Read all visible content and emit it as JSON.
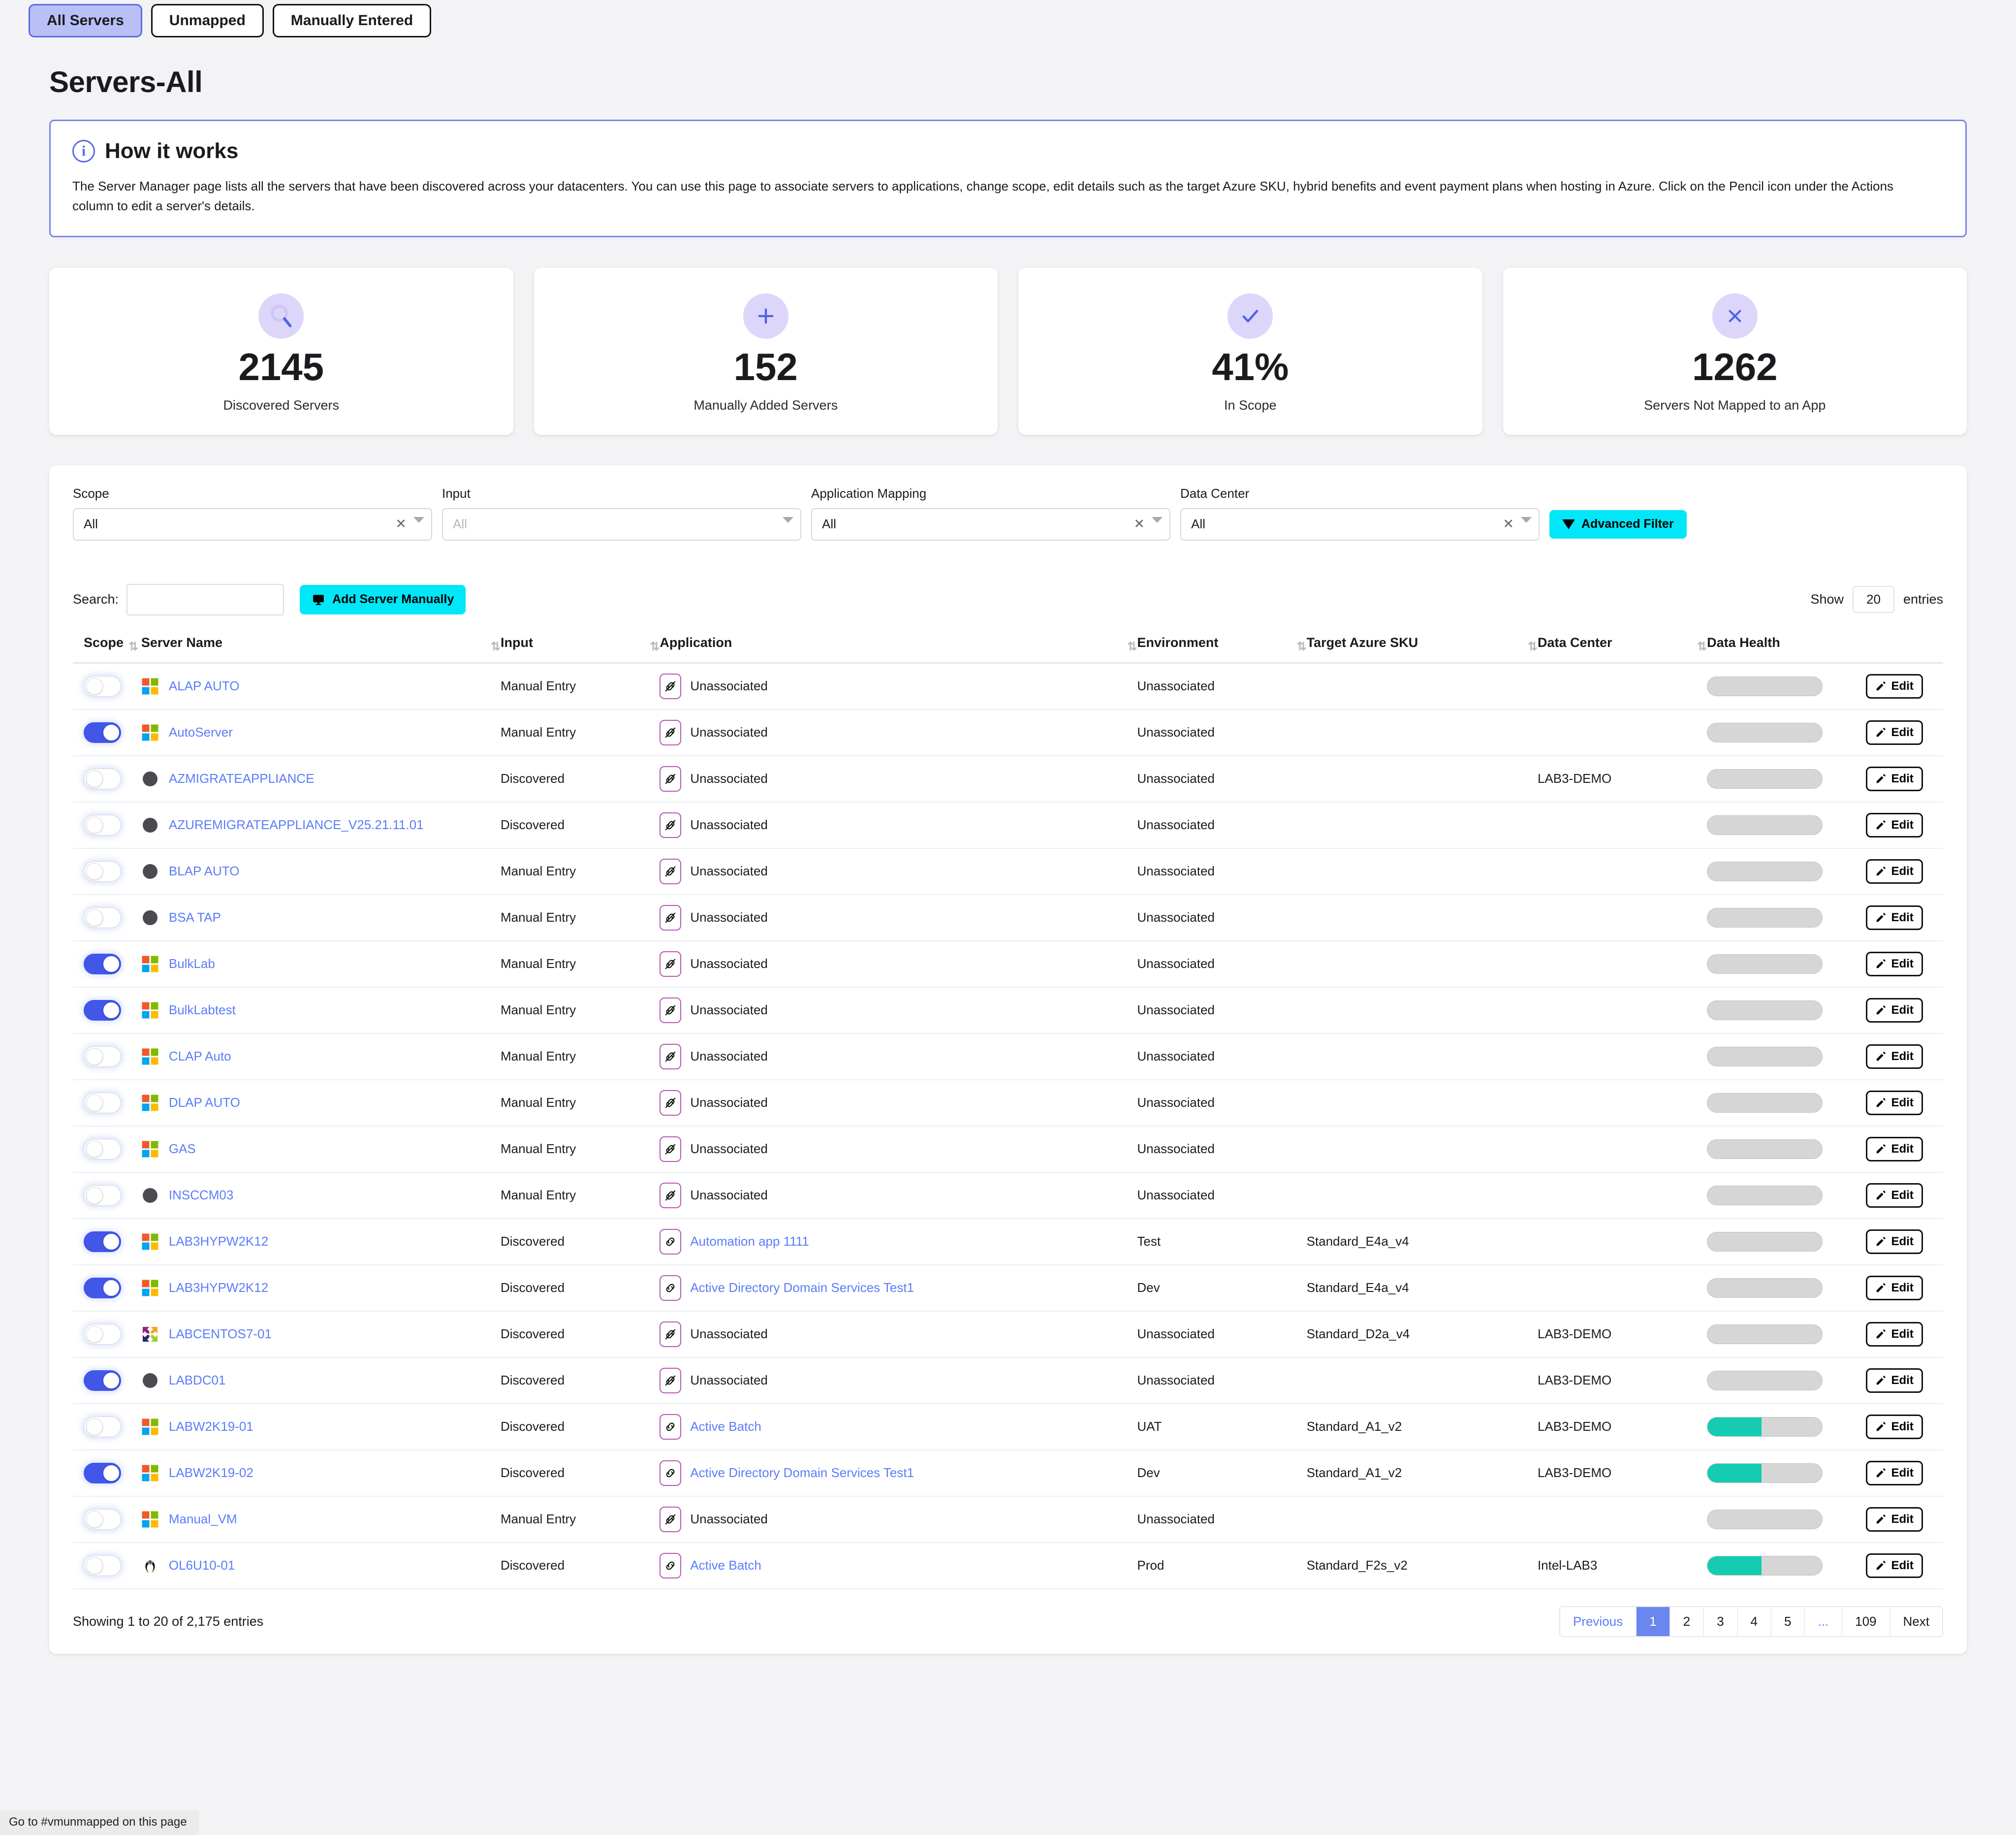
{
  "tabs": [
    {
      "label": "All Servers",
      "active": true
    },
    {
      "label": "Unmapped",
      "active": false
    },
    {
      "label": "Manually Entered",
      "active": false
    }
  ],
  "page_title": "Servers-All",
  "how_it_works": {
    "icon": "info-icon",
    "title": "How it works",
    "body": "The Server Manager page lists all the servers that have been discovered across your datacenters. You can use this page to associate servers to applications, change scope, edit details such as the target Azure SKU, hybrid benefits and event payment plans when hosting in Azure. Click on the Pencil icon under the Actions column to edit a server's details."
  },
  "stats": [
    {
      "icon": "magnifier-icon",
      "value": "2145",
      "label": "Discovered Servers"
    },
    {
      "icon": "plus-icon",
      "value": "152",
      "label": "Manually Added Servers"
    },
    {
      "icon": "check-icon",
      "value": "41%",
      "label": "In Scope"
    },
    {
      "icon": "x-icon",
      "value": "1262",
      "label": "Servers Not Mapped to an App"
    }
  ],
  "filters": [
    {
      "label": "Scope",
      "value": "All",
      "placeholder": "All",
      "has_clear": true,
      "is_placeholder": false
    },
    {
      "label": "Input",
      "value": "All",
      "placeholder": "All",
      "has_clear": false,
      "is_placeholder": true
    },
    {
      "label": "Application Mapping",
      "value": "All",
      "placeholder": "All",
      "has_clear": true,
      "is_placeholder": false
    },
    {
      "label": "Data Center",
      "value": "All",
      "placeholder": "All",
      "has_clear": true,
      "is_placeholder": false
    }
  ],
  "advanced_filter_label": "Advanced Filter",
  "advanced_filter_color": "#00e7f7",
  "search": {
    "label": "Search:",
    "value": "",
    "placeholder": ""
  },
  "add_server_label": "Add Server Manually",
  "show_entries": {
    "prefix": "Show",
    "value": "20",
    "suffix": "entries"
  },
  "table": {
    "columns": [
      "Scope",
      "Server Name",
      "Input",
      "Application",
      "Environment",
      "Target Azure SKU",
      "Data Center",
      "Data Health"
    ],
    "rows": [
      {
        "scope_on": false,
        "os": "windows",
        "name": "ALAP AUTO",
        "input": "Manual Entry",
        "app": "Unassociated",
        "app_linked": false,
        "env": "Unassociated",
        "sku": "",
        "dc": "",
        "health": 0,
        "action": "Edit"
      },
      {
        "scope_on": true,
        "os": "windows",
        "name": "AutoServer",
        "input": "Manual Entry",
        "app": "Unassociated",
        "app_linked": false,
        "env": "Unassociated",
        "sku": "",
        "dc": "",
        "health": 0,
        "action": "Edit"
      },
      {
        "scope_on": false,
        "os": "generic",
        "name": "AZMIGRATEAPPLIANCE",
        "input": "Discovered",
        "app": "Unassociated",
        "app_linked": false,
        "env": "Unassociated",
        "sku": "",
        "dc": "LAB3-DEMO",
        "health": 0,
        "action": "Edit"
      },
      {
        "scope_on": false,
        "os": "generic",
        "name": "AZUREMIGRATEAPPLIANCE_V25.21.11.01",
        "input": "Discovered",
        "app": "Unassociated",
        "app_linked": false,
        "env": "Unassociated",
        "sku": "",
        "dc": "",
        "health": 0,
        "action": "Edit"
      },
      {
        "scope_on": false,
        "os": "generic",
        "name": "BLAP AUTO",
        "input": "Manual Entry",
        "app": "Unassociated",
        "app_linked": false,
        "env": "Unassociated",
        "sku": "",
        "dc": "",
        "health": 0,
        "action": "Edit"
      },
      {
        "scope_on": false,
        "os": "generic",
        "name": "BSA TAP",
        "input": "Manual Entry",
        "app": "Unassociated",
        "app_linked": false,
        "env": "Unassociated",
        "sku": "",
        "dc": "",
        "health": 0,
        "action": "Edit"
      },
      {
        "scope_on": true,
        "os": "windows",
        "name": "BulkLab",
        "input": "Manual Entry",
        "app": "Unassociated",
        "app_linked": false,
        "env": "Unassociated",
        "sku": "",
        "dc": "",
        "health": 0,
        "action": "Edit"
      },
      {
        "scope_on": true,
        "os": "windows",
        "name": "BulkLabtest",
        "input": "Manual Entry",
        "app": "Unassociated",
        "app_linked": false,
        "env": "Unassociated",
        "sku": "",
        "dc": "",
        "health": 0,
        "action": "Edit"
      },
      {
        "scope_on": false,
        "os": "windows",
        "name": "CLAP Auto",
        "input": "Manual Entry",
        "app": "Unassociated",
        "app_linked": false,
        "env": "Unassociated",
        "sku": "",
        "dc": "",
        "health": 0,
        "action": "Edit"
      },
      {
        "scope_on": false,
        "os": "windows",
        "name": "DLAP AUTO",
        "input": "Manual Entry",
        "app": "Unassociated",
        "app_linked": false,
        "env": "Unassociated",
        "sku": "",
        "dc": "",
        "health": 0,
        "action": "Edit"
      },
      {
        "scope_on": false,
        "os": "windows",
        "name": "GAS",
        "input": "Manual Entry",
        "app": "Unassociated",
        "app_linked": false,
        "env": "Unassociated",
        "sku": "",
        "dc": "",
        "health": 0,
        "action": "Edit"
      },
      {
        "scope_on": false,
        "os": "generic",
        "name": "INSCCM03",
        "input": "Manual Entry",
        "app": "Unassociated",
        "app_linked": false,
        "env": "Unassociated",
        "sku": "",
        "dc": "",
        "health": 0,
        "action": "Edit"
      },
      {
        "scope_on": true,
        "os": "windows",
        "name": "LAB3HYPW2K12",
        "input": "Discovered",
        "app": "Automation app 1111",
        "app_linked": true,
        "env": "Test",
        "sku": "Standard_E4a_v4",
        "dc": "",
        "health": 0,
        "action": "Edit"
      },
      {
        "scope_on": true,
        "os": "windows",
        "name": "LAB3HYPW2K12",
        "input": "Discovered",
        "app": "Active Directory Domain Services Test1",
        "app_linked": true,
        "env": "Dev",
        "sku": "Standard_E4a_v4",
        "dc": "",
        "health": 0,
        "action": "Edit"
      },
      {
        "scope_on": false,
        "os": "centos",
        "name": "LABCENTOS7-01",
        "input": "Discovered",
        "app": "Unassociated",
        "app_linked": false,
        "env": "Unassociated",
        "sku": "Standard_D2a_v4",
        "dc": "LAB3-DEMO",
        "health": 0,
        "action": "Edit"
      },
      {
        "scope_on": true,
        "os": "generic",
        "name": "LABDC01",
        "input": "Discovered",
        "app": "Unassociated",
        "app_linked": false,
        "env": "Unassociated",
        "sku": "",
        "dc": "LAB3-DEMO",
        "health": 0,
        "action": "Edit"
      },
      {
        "scope_on": false,
        "os": "windows",
        "name": "LABW2K19-01",
        "input": "Discovered",
        "app": "Active Batch",
        "app_linked": true,
        "env": "UAT",
        "sku": "Standard_A1_v2",
        "dc": "LAB3-DEMO",
        "health": 47,
        "action": "Edit"
      },
      {
        "scope_on": true,
        "os": "windows",
        "name": "LABW2K19-02",
        "input": "Discovered",
        "app": "Active Directory Domain Services Test1",
        "app_linked": true,
        "env": "Dev",
        "sku": "Standard_A1_v2",
        "dc": "LAB3-DEMO",
        "health": 47,
        "action": "Edit"
      },
      {
        "scope_on": false,
        "os": "windows",
        "name": "Manual_VM",
        "input": "Manual Entry",
        "app": "Unassociated",
        "app_linked": false,
        "env": "Unassociated",
        "sku": "",
        "dc": "",
        "health": 0,
        "action": "Edit"
      },
      {
        "scope_on": false,
        "os": "linux",
        "name": "OL6U10-01",
        "input": "Discovered",
        "app": "Active Batch",
        "app_linked": true,
        "env": "Prod",
        "sku": "Standard_F2s_v2",
        "dc": "Intel-LAB3",
        "health": 47,
        "action": "Edit"
      }
    ]
  },
  "footer": {
    "showing": "Showing 1 to 20 of 2,175 entries",
    "pager": [
      "Previous",
      "1",
      "2",
      "3",
      "4",
      "5",
      "...",
      "109",
      "Next"
    ],
    "current_page": "1"
  },
  "status_bar": "Go to #vmunmapped on this page"
}
